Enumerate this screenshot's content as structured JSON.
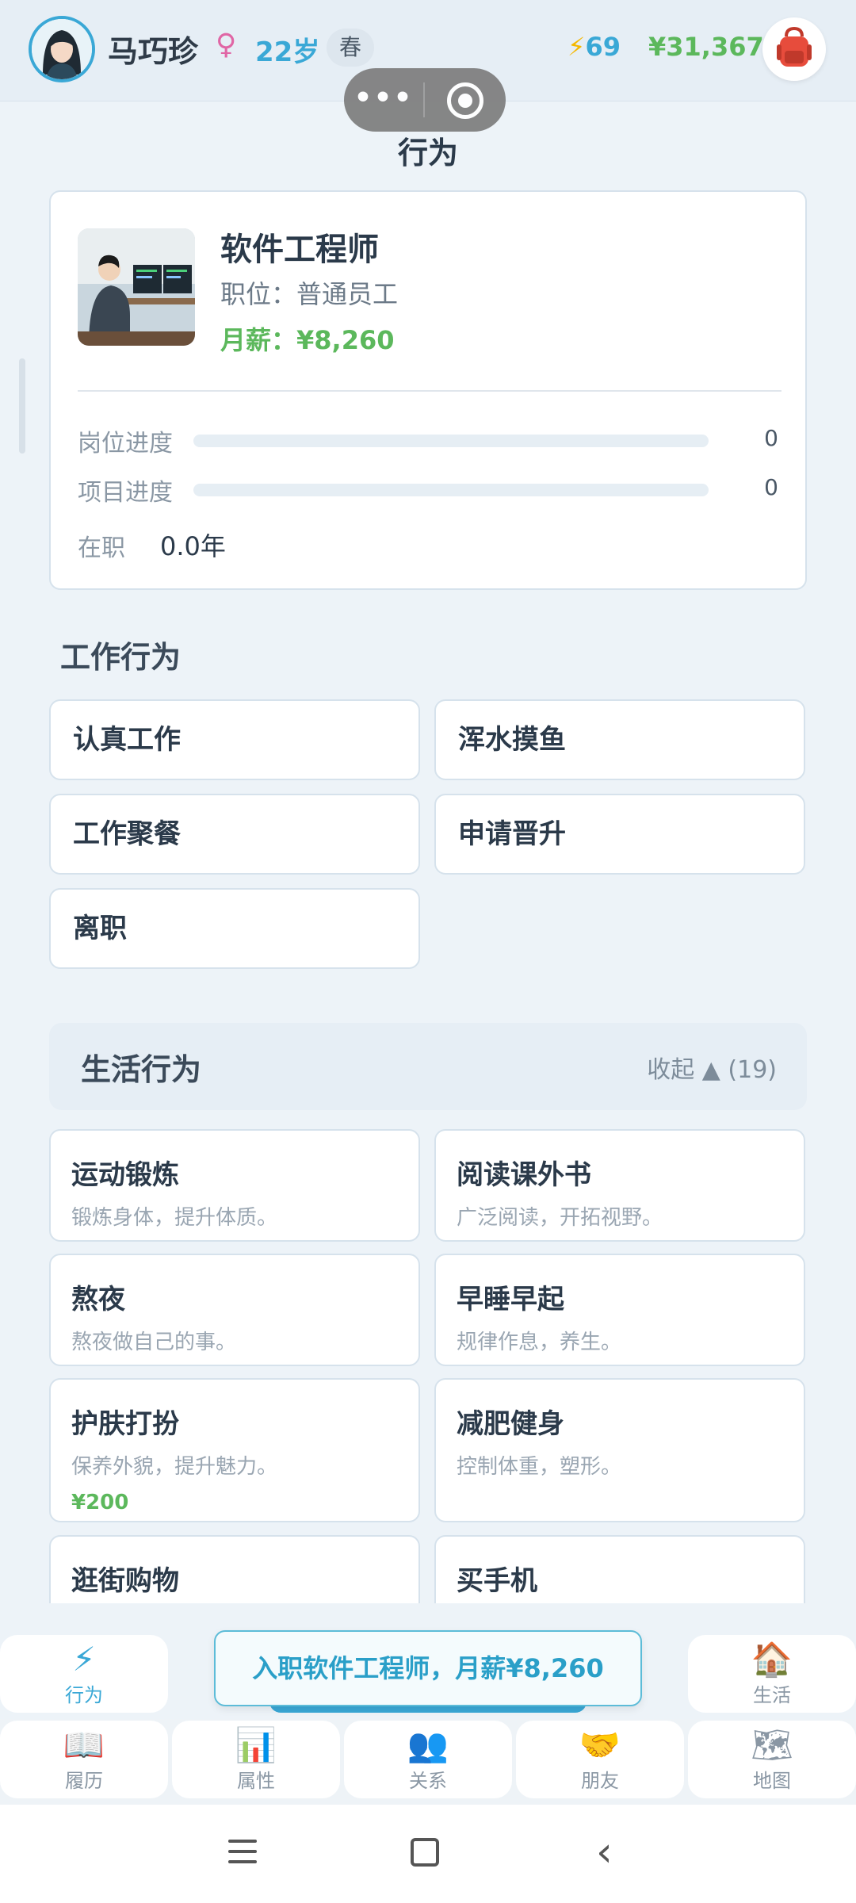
{
  "header": {
    "name": "马巧珍",
    "gender_symbol": "♀",
    "age": "22岁",
    "season": "春",
    "energy": "69",
    "money": "¥31,367"
  },
  "page": {
    "title": "行为"
  },
  "job": {
    "title": "软件工程师",
    "position": "职位：普通员工",
    "salary": "月薪：¥8,260",
    "progress": [
      {
        "label": "岗位进度",
        "value": "0",
        "fraction": 0
      },
      {
        "label": "项目进度",
        "value": "0",
        "fraction": 0
      }
    ],
    "tenure_label": "在职",
    "tenure_value": "0.0年"
  },
  "work": {
    "title": "工作行为",
    "actions": [
      "认真工作",
      "浑水摸鱼",
      "工作聚餐",
      "申请晋升",
      "离职"
    ]
  },
  "life": {
    "title": "生活行为",
    "toggle": "收起 ▲ (19)",
    "actions": [
      {
        "name": "运动锻炼",
        "desc": "锻炼身体，提升体质。",
        "cost": ""
      },
      {
        "name": "阅读课外书",
        "desc": "广泛阅读，开拓视野。",
        "cost": ""
      },
      {
        "name": "熬夜",
        "desc": "熬夜做自己的事。",
        "cost": ""
      },
      {
        "name": "早睡早起",
        "desc": "规律作息，养生。",
        "cost": ""
      },
      {
        "name": "护肤打扮",
        "desc": "保养外貌，提升魅力。",
        "cost": "¥200"
      },
      {
        "name": "减肥健身",
        "desc": "控制体重，塑形。",
        "cost": ""
      },
      {
        "name": "逛街购物",
        "desc": "",
        "cost": ""
      },
      {
        "name": "买手机",
        "desc": "",
        "cost": ""
      }
    ]
  },
  "toast": "入职软件工程师，月薪¥8,260",
  "nav": {
    "row1": [
      {
        "label": "行为",
        "icon": "lightning-icon"
      },
      {
        "label": "生活",
        "icon": "house-icon"
      }
    ],
    "row2": [
      {
        "label": "履历",
        "icon": "book-icon"
      },
      {
        "label": "属性",
        "icon": "chart-icon"
      },
      {
        "label": "关系",
        "icon": "people-icon"
      },
      {
        "label": "朋友",
        "icon": "handshake-icon"
      },
      {
        "label": "地图",
        "icon": "map-icon"
      }
    ]
  },
  "colors": {
    "accent": "#3aa8d6",
    "money": "#5cb85c",
    "gender": "#e066a5"
  }
}
